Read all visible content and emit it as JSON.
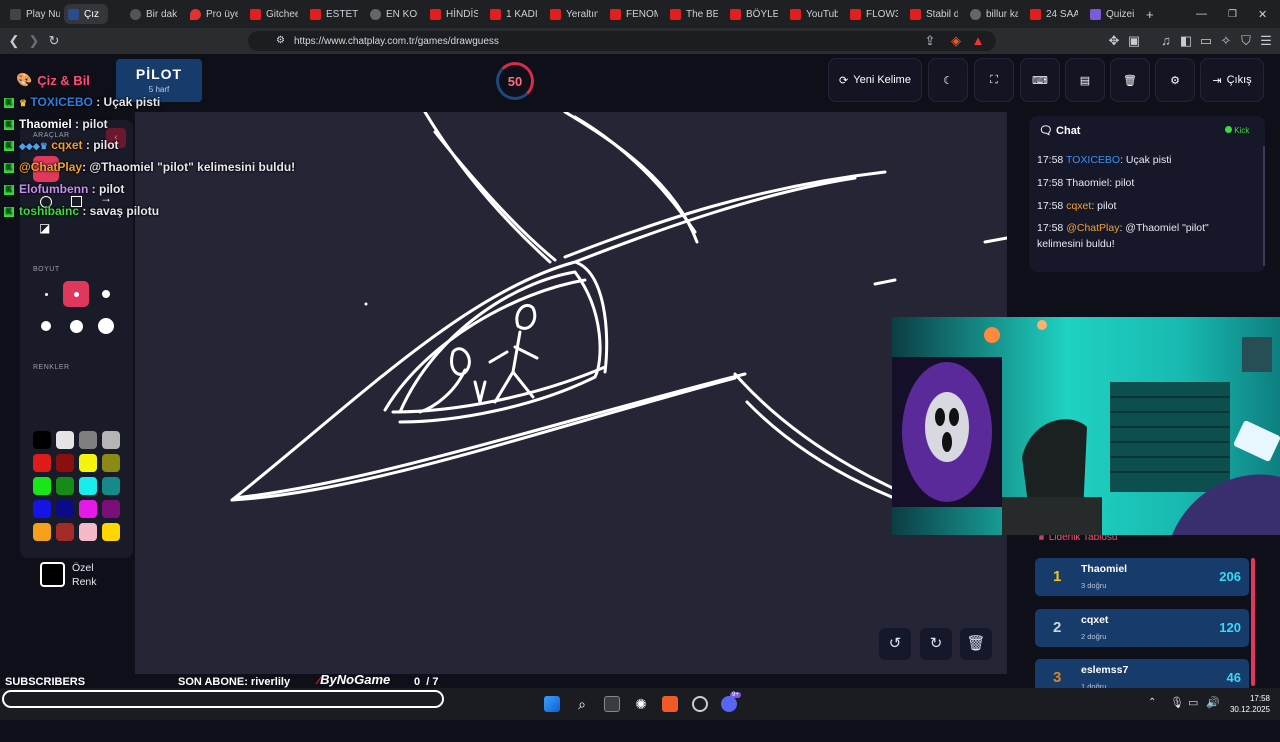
{
  "browser": {
    "tabs": [
      "Play Nu",
      "Çız",
      "Bir dakı",
      "Pro üye",
      "Gitchee",
      "ESTETİ",
      "EN KOM",
      "HİNDİS",
      "1 KADI",
      "Yeraltın",
      "FENOM",
      "The BES",
      "BÖYLE Y",
      "YouTub",
      "FLOW3",
      "Stabil d",
      "billur ka",
      "24 SAA",
      "Quizei"
    ],
    "new_tab": "+",
    "url": "https://www.chatplay.com.tr/games/drawguess"
  },
  "app": {
    "brand": "Çiz & Bil",
    "word": "PİLOT",
    "word_hint": "5 harf",
    "timer": "50",
    "buttons": {
      "new_word": "Yeni Kelime",
      "exit": "Çıkış"
    },
    "tools": {
      "section_tools": "ARAÇLAR",
      "section_size": "BOYUT",
      "section_colors": "RENKLER",
      "custom_color_line1": "Özel",
      "custom_color_line2": "Renk",
      "colors": [
        "#000000",
        "#e5e5e5",
        "#7f7f7f",
        "#b5b5b5",
        "#e01b1b",
        "#8b0f0f",
        "#f4f40f",
        "#8a8a14",
        "#19e619",
        "#168c16",
        "#19ecec",
        "#168a8a",
        "#1414e6",
        "#0b0b8a",
        "#e619e6",
        "#7a0f7a",
        "#f4a018",
        "#a52a2a",
        "#f5b8c8",
        "#ffd700"
      ]
    },
    "overlay_chat": [
      {
        "user": "TOXICEBO",
        "msg": " : Uçak pisti",
        "color": "#2b7de0"
      },
      {
        "user": "Thaomiel",
        "msg": " : pilot",
        "color": "#ffffff"
      },
      {
        "user": "cqxet",
        "msg": " : pilot",
        "color": "#f0a030"
      },
      {
        "user": "@ChatPlay",
        "msg": ": @Thaomiel \"pilot\" kelimesini buldu!",
        "color": "#f0a030"
      },
      {
        "user": "Elofumbenn",
        "msg": " : pilot",
        "color": "#c58ef0"
      },
      {
        "user": "toshibainc",
        "msg": " : savaş pilotu",
        "color": "#3ddc3d"
      }
    ],
    "chat": {
      "title": "Chat",
      "platform": "Kick",
      "messages": [
        {
          "time": "17:58",
          "user": "TOXICEBO",
          "text": ": Uçak pisti",
          "color": "#3b8ff5"
        },
        {
          "time": "17:58",
          "user": "Thaomiel",
          "text": ": pilot",
          "color": "#e8e8ef"
        },
        {
          "time": "17:58",
          "user": "cqxet",
          "text": ": pilot",
          "color": "#f0a030"
        },
        {
          "time": "17:58",
          "user": "@ChatPlay",
          "text": ": @Thaomiel \"pilot\"",
          "text2": "kelimesini buldu!",
          "color": "#f0a030"
        }
      ]
    },
    "leaderboard": {
      "title": "Liderlik Tablosu",
      "rows": [
        {
          "rank": "1",
          "name": "Thaomiel",
          "sub": "3 doğru",
          "score": "206",
          "rank_color": "#f5c518"
        },
        {
          "rank": "2",
          "name": "cqxet",
          "sub": "2 doğru",
          "score": "120",
          "rank_color": "#d0d4dc"
        },
        {
          "rank": "3",
          "name": "eslemss7",
          "sub": "1 doğru",
          "score": "46",
          "rank_color": "#d9822b"
        }
      ]
    },
    "stream": {
      "subscribers_label": "SUBSCRIBERS",
      "last_sub": "SON ABONE: riverlily",
      "logo": "ByNoGame",
      "sub_count": "0  / 7"
    }
  },
  "taskbar": {
    "time": "17:58",
    "date": "30.12.2025",
    "badge": "9+"
  }
}
